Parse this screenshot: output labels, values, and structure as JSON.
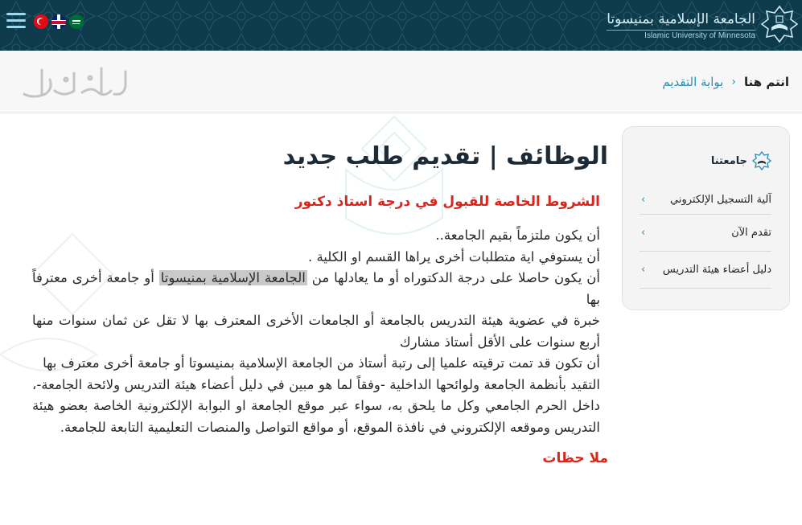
{
  "header": {
    "logo_ar": "الجامعة الإسلامية بمنيسوتا",
    "logo_en": "Islamic University of Minnesota",
    "languages": [
      {
        "name": "Turkish",
        "icon": "turkey-flag-icon"
      },
      {
        "name": "English",
        "icon": "uk-flag-icon"
      },
      {
        "name": "Arabic",
        "icon": "saudi-flag-icon"
      }
    ],
    "menu_icon": "hamburger-menu-icon"
  },
  "breadcrumb": {
    "here": "انتم هنا",
    "separator": "›",
    "current": "بوابة التقديم"
  },
  "main": {
    "title": "الوظائف | تقديم طلب جديد",
    "section_title": "الشروط الخاصة للقبول في درجة استاذ دكتور",
    "items": [
      "أن يكون ملتزماً بقيم الجامعة..",
      "أن يستوفي اية متطلبات أخرى يراها القسم او الكلية .",
      "خبرة في عضوية هيئة التدريس بالجامعة أو الجامعات الأخرى المعترف بها لا تقل عن ثمان سنوات منها أربع سنوات على الأقل أستاذ مشارك",
      "أن تكون قد تمت ترقيته علميا إلى رتبة أستاذ من الجامعة الإسلامية بمنيسوتا أو جامعة أخرى معترف بها",
      "التقيد بأنظمة الجامعة ولوائحها الداخلية -وفقاً لما هو مبين في دليل أعضاء هيئة التدريس ولائحة الجامعة-، داخل الحرم الجامعي وكل ما يلحق به، سواء عبر موقع الجامعة او البوابة الإلكترونية الخاصة بعضو هيئة التدريس وموقعه الإلكتروني في نافذة الموقع، أو مواقع التواصل والمنصات التعليمية التابعة للجامعة."
    ],
    "degree_item": {
      "before": "أن يكون حاصلا على درجة الدكتوراه أو ما يعادلها من ",
      "highlight": "الجامعة الإسلامية بمنيسوتا",
      "after": " أو جامعة أخرى معترفاً بها"
    },
    "notes_title": "ملا حظات"
  },
  "sidebar": {
    "title": "جامعتنا",
    "items": [
      {
        "label": "آلية التسجيل الإلكتروني"
      },
      {
        "label": "تقدم الآن"
      },
      {
        "label": "دليل أعضاء هيئة التدريس"
      }
    ]
  },
  "colors": {
    "header_bg": "#0e3b4c",
    "accent": "#2b8fb3",
    "section_red": "#d9261c",
    "title_dark": "#1d2b36"
  }
}
